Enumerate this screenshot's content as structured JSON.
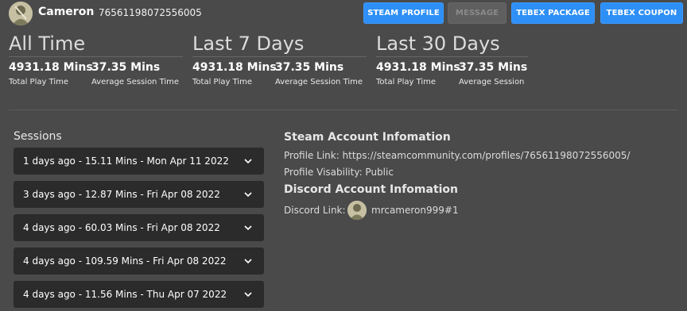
{
  "user": {
    "name": "Cameron",
    "steam_id": "76561198072556005"
  },
  "buttons": {
    "steam_profile": "STEAM PROFILE",
    "message": "MESSAGE",
    "tebex_package": "TEBEX PACKAGE",
    "tebex_coupon": "TEBEX COUPON"
  },
  "stats": [
    {
      "period": "All Time",
      "total_value": "4931.18 Mins",
      "total_label": "Total Play Time",
      "avg_value": "37.35 Mins",
      "avg_label": "Average Session Time"
    },
    {
      "period": "Last 7 Days",
      "total_value": "4931.18 Mins",
      "total_label": "Total Play Time",
      "avg_value": "37.35 Mins",
      "avg_label": "Average Session Time"
    },
    {
      "period": "Last 30 Days",
      "total_value": "4931.18 Mins",
      "total_label": "Total Play Time",
      "avg_value": "37.35 Mins",
      "avg_label": "Average Session"
    }
  ],
  "sessions": {
    "title": "Sessions",
    "items": [
      "1 days ago - 15.11 Mins - Mon Apr 11 2022",
      "3 days ago - 12.87 Mins - Fri Apr 08 2022",
      "4 days ago - 60.03 Mins - Fri Apr 08 2022",
      "4 days ago - 109.59 Mins - Fri Apr 08 2022",
      "4 days ago - 11.56 Mins - Thu Apr 07 2022"
    ]
  },
  "steam_info": {
    "heading": "Steam Account Infomation",
    "profile_link": "Profile Link: https://steamcommunity.com/profiles/76561198072556005/",
    "visibility": "Profile Visability: Public"
  },
  "discord_info": {
    "heading": "Discord Account Infomation",
    "link_label": "Discord Link:",
    "username": "mrcameron999#1"
  },
  "colors": {
    "background": "#4a4a4a",
    "accent": "#2e8ff6",
    "session_bg": "#2b2b2b"
  }
}
